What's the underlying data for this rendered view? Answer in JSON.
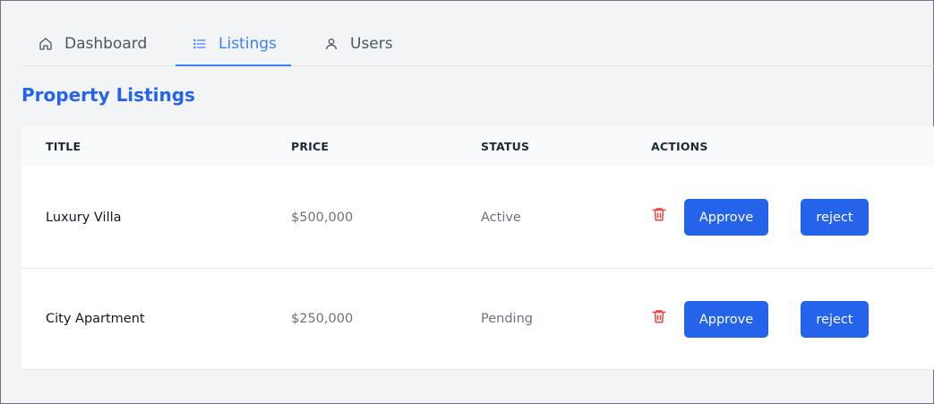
{
  "tabs": [
    {
      "label": "Dashboard",
      "icon": "home-icon"
    },
    {
      "label": "Listings",
      "icon": "list-icon",
      "active": true
    },
    {
      "label": "Users",
      "icon": "user-icon"
    }
  ],
  "page": {
    "title": "Property Listings"
  },
  "table": {
    "headers": [
      "TITLE",
      "PRICE",
      "STATUS",
      "ACTIONS"
    ],
    "rows": [
      {
        "title": "Luxury Villa",
        "price": "$500,000",
        "status": "Active",
        "approve_label": "Approve",
        "reject_label": "reject"
      },
      {
        "title": "City Apartment",
        "price": "$250,000",
        "status": "Pending",
        "approve_label": "Approve",
        "reject_label": "reject"
      }
    ]
  },
  "colors": {
    "accent": "#2563eb",
    "delete": "#ef4444"
  }
}
